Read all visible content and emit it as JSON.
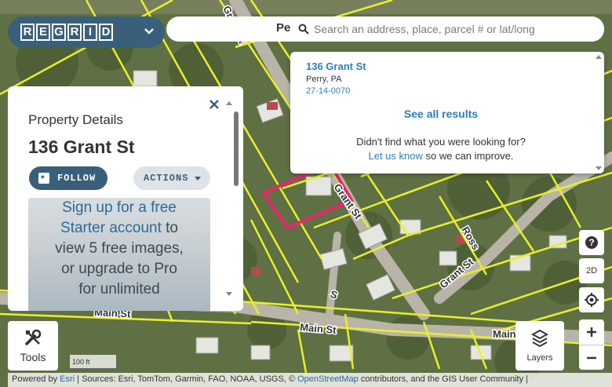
{
  "brand": {
    "name": "REGRID",
    "letters": [
      "R",
      "E",
      "G",
      "R",
      "I",
      "D"
    ]
  },
  "topbar": {
    "place_fragment": "Pe"
  },
  "search": {
    "placeholder": "Search an address, place, parcel # or lat/long",
    "value": ""
  },
  "results": {
    "items": [
      {
        "title": "136 Grant St",
        "subtitle": "Perry, PA",
        "parcel_id": "27-14-0070"
      }
    ],
    "see_all_label": "See all results",
    "not_found_text": "Didn't find what you were looking for?",
    "let_us_know_label": "Let us know",
    "improve_text": "so we can improve."
  },
  "panel": {
    "heading": "Property Details",
    "address": "136 Grant St",
    "follow_label": "FOLLOW",
    "actions_label": "ACTIONS",
    "upsell_lines": [
      {
        "text": "Sign up for a free",
        "kind": "link"
      },
      {
        "text": "Starter account",
        "kind": "link"
      },
      {
        "text": "to",
        "kind": "plain"
      },
      {
        "text": "view 5 free images,",
        "kind": "plain"
      },
      {
        "text": "or upgrade to Pro",
        "kind": "plain"
      },
      {
        "text": "for unlimited",
        "kind": "plain"
      }
    ],
    "upsell_line1": "Sign up for a free",
    "upsell_line2_link": "Starter account",
    "upsell_line2_rest": " to",
    "upsell_line3": "view 5 free images,",
    "upsell_line4": "or upgrade to Pro",
    "upsell_line5": "for unlimited"
  },
  "controls": {
    "help": "?",
    "view_mode": "2D",
    "locate_icon": "crosshair-icon",
    "zoom_in": "+",
    "zoom_out": "−"
  },
  "tools": {
    "label": "Tools"
  },
  "layers": {
    "label": "Layers"
  },
  "scale": {
    "label": "100 ft"
  },
  "map_labels": {
    "grant_st_1": "Grant St",
    "grant_st_2": "Grant St",
    "grant_st_3": "Grant St",
    "main_st_1": "Main St",
    "main_st_2": "Main St",
    "main_st_3": "Main",
    "ross": "Ross",
    "n_st": "S"
  },
  "attribution": {
    "powered_by": "Powered by",
    "esri": "Esri",
    "sources": " | Sources: Esri, TomTom, Garmin, FAO, NOAA, USGS, © ",
    "osm": "OpenStreetMap",
    "rest": " contributors, and the GIS User Community |"
  },
  "colors": {
    "brand": "#3a5f7a",
    "link": "#2c7fb8",
    "parcel_lines": "#e8f02a",
    "selected_parcel": "#e8276b"
  }
}
